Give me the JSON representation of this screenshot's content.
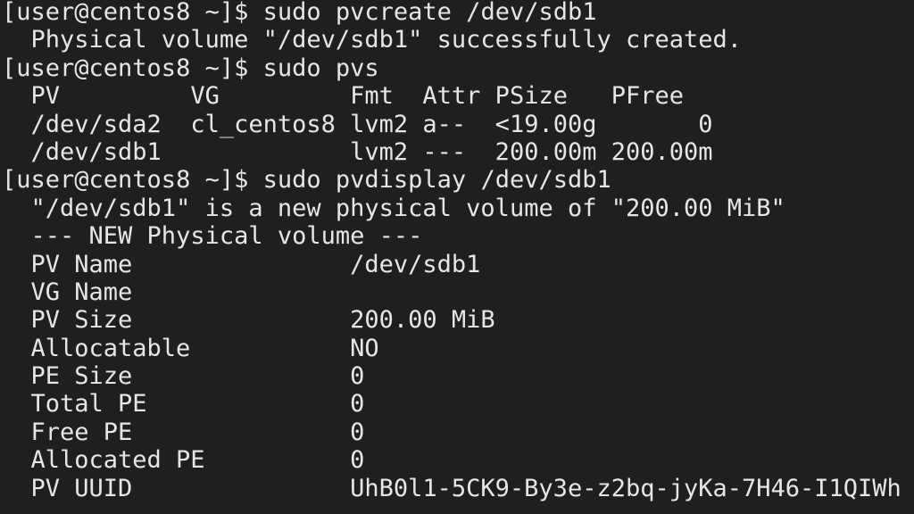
{
  "terminal": {
    "prompt": "[user@centos8 ~]$ ",
    "cmd1": "sudo pvcreate /dev/sdb1",
    "out1": "  Physical volume \"/dev/sdb1\" successfully created.",
    "cmd2": "sudo pvs",
    "pvs": {
      "header": "  PV         VG         Fmt  Attr PSize   PFree  ",
      "rows": [
        "  /dev/sda2  cl_centos8 lvm2 a--  <19.00g       0",
        "  /dev/sdb1             lvm2 ---  200.00m 200.00m"
      ]
    },
    "cmd3": "sudo pvdisplay /dev/sdb1",
    "out3": "  \"/dev/sdb1\" is a new physical volume of \"200.00 MiB\"",
    "section": "  --- NEW Physical volume ---",
    "fields": [
      {
        "label": "PV Name",
        "value": "/dev/sdb1"
      },
      {
        "label": "VG Name",
        "value": ""
      },
      {
        "label": "PV Size",
        "value": "200.00 MiB"
      },
      {
        "label": "Allocatable",
        "value": "NO"
      },
      {
        "label": "PE Size",
        "value": "0"
      },
      {
        "label": "Total PE",
        "value": "0"
      },
      {
        "label": "Free PE",
        "value": "0"
      },
      {
        "label": "Allocated PE",
        "value": "0"
      },
      {
        "label": "PV UUID",
        "value": "UhB0l1-5CK9-By3e-z2bq-jyKa-7H46-I1QIWh"
      }
    ]
  }
}
